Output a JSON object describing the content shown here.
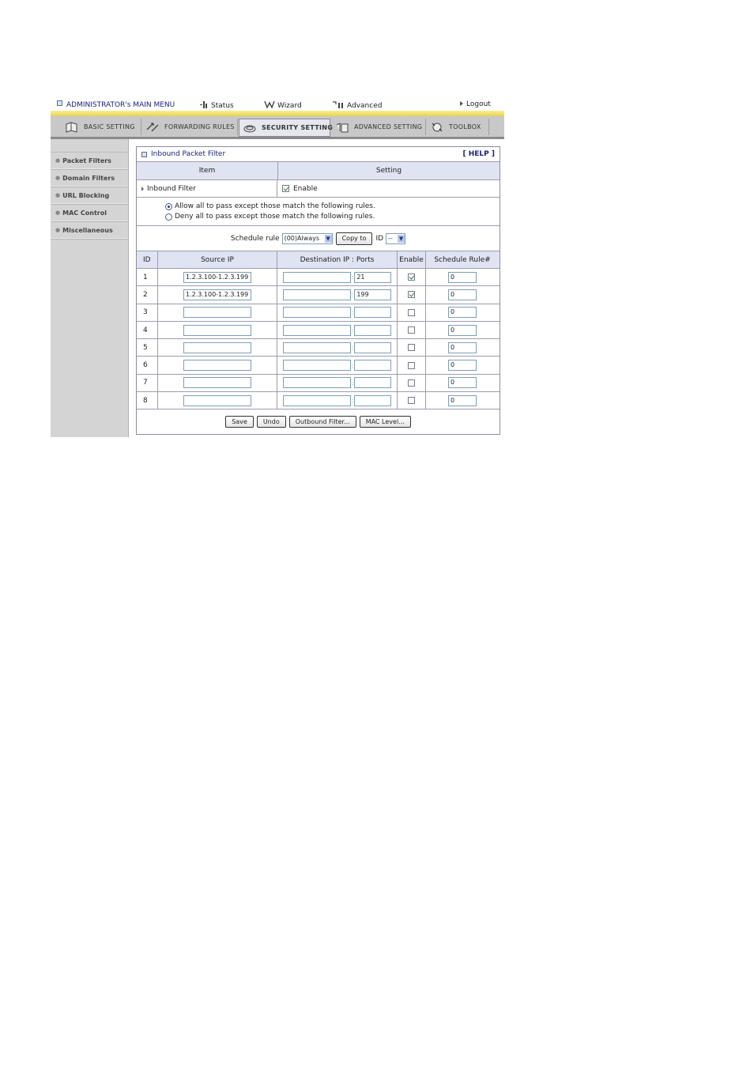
{
  "topmenu": {
    "admin": "ADMINISTRATOR's MAIN MENU",
    "status": "Status",
    "wizard": "Wizard",
    "advanced": "Advanced",
    "logout": "Logout"
  },
  "tabs": {
    "basic": "BASIC SETTING",
    "forwarding": "FORWARDING RULES",
    "security": "SECURITY SETTING",
    "advanced": "ADVANCED SETTING",
    "toolbox": "TOOLBOX"
  },
  "sidebar": {
    "items": [
      {
        "label": "Packet Filters"
      },
      {
        "label": "Domain Filters"
      },
      {
        "label": "URL Blocking"
      },
      {
        "label": "MAC Control"
      },
      {
        "label": "Miscellaneous"
      }
    ]
  },
  "panel": {
    "title": "Inbound Packet Filter",
    "help": "[ HELP ]",
    "col_item": "Item",
    "col_setting": "Setting",
    "inbound_label": "Inbound Filter",
    "enable_label": "Enable",
    "allow_text": "Allow all to pass except those match the following rules.",
    "deny_text": "Deny all to pass except those match the following rules.",
    "schedule_label": "Schedule rule",
    "schedule_value": "(00)Always",
    "copy_to": "Copy to",
    "id_label": "ID",
    "id_value": "--"
  },
  "table": {
    "headers": {
      "id": "ID",
      "source": "Source IP",
      "dest": "Destination IP : Ports",
      "enable": "Enable",
      "rule": "Schedule Rule#"
    },
    "rows": [
      {
        "id": "1",
        "source": "1.2.3.100-1.2.3.199",
        "dest": "",
        "port": "21",
        "enabled": true,
        "rule": "0"
      },
      {
        "id": "2",
        "source": "1.2.3.100-1.2.3.199",
        "dest": "",
        "port": "199",
        "enabled": true,
        "rule": "0"
      },
      {
        "id": "3",
        "source": "",
        "dest": "",
        "port": "",
        "enabled": false,
        "rule": "0"
      },
      {
        "id": "4",
        "source": "",
        "dest": "",
        "port": "",
        "enabled": false,
        "rule": "0"
      },
      {
        "id": "5",
        "source": "",
        "dest": "",
        "port": "",
        "enabled": false,
        "rule": "0"
      },
      {
        "id": "6",
        "source": "",
        "dest": "",
        "port": "",
        "enabled": false,
        "rule": "0"
      },
      {
        "id": "7",
        "source": "",
        "dest": "",
        "port": "",
        "enabled": false,
        "rule": "0"
      },
      {
        "id": "8",
        "source": "",
        "dest": "",
        "port": "",
        "enabled": false,
        "rule": "0"
      }
    ]
  },
  "buttons": {
    "save": "Save",
    "undo": "Undo",
    "outbound": "Outbound Filter...",
    "mac": "MAC Level..."
  }
}
